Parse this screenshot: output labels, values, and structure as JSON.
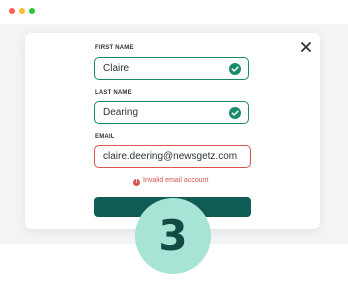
{
  "window": {
    "controls": [
      "red",
      "yellow",
      "green"
    ]
  },
  "form": {
    "first_name": {
      "label": "FIRST NAME",
      "value": "Claire",
      "status": "valid"
    },
    "last_name": {
      "label": "LAST NAME",
      "value": "Dearing",
      "status": "valid"
    },
    "email": {
      "label": "EMAIL",
      "value": "claire.deering@newsgetz.com",
      "status": "error",
      "error_message": "Invalid email account"
    },
    "submit_label": ""
  },
  "step": {
    "number": "3"
  },
  "colors": {
    "valid": "#1a8a6a",
    "error": "#d9534f",
    "button": "#0f5c55",
    "badge": "#a8e4d6",
    "badge_text": "#134a43"
  },
  "icons": {
    "close": "close-icon",
    "valid": "check-circle-icon",
    "error": "error-circle-icon"
  }
}
